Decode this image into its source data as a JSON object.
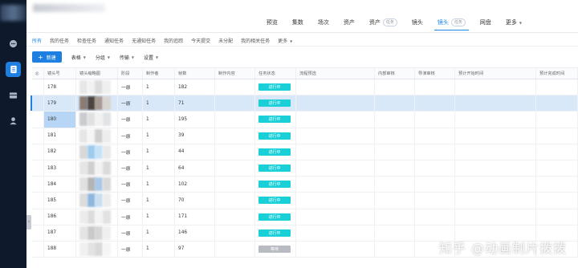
{
  "header": {
    "tabs": [
      {
        "label": "预览",
        "badge": null
      },
      {
        "label": "集数",
        "badge": null
      },
      {
        "label": "场次",
        "badge": null
      },
      {
        "label": "资产",
        "badge": null
      },
      {
        "label": "资产",
        "badge": "任务"
      },
      {
        "label": "镜头",
        "badge": null
      },
      {
        "label": "镜头",
        "badge": "任务",
        "active": true
      },
      {
        "label": "网盘",
        "badge": null
      },
      {
        "label": "更多",
        "badge": null
      }
    ]
  },
  "subtabs": [
    "所有",
    "我的任务",
    "检查任务",
    "通知任务",
    "无通知任务",
    "我的追踪",
    "今天提交",
    "未分配",
    "我的相关任务",
    "更多"
  ],
  "toolbar": {
    "new_label": "新建",
    "items": [
      "表格",
      "分组",
      "传输",
      "设置"
    ]
  },
  "table": {
    "columns": [
      "",
      "镜头号",
      "镜头缩略图",
      "阶段",
      "制作者",
      "帧数",
      "制作内容",
      "任务状态",
      "流程预选",
      "内部审核",
      "导演审核",
      "预计开始时间",
      "预计完成时间"
    ],
    "rows": [
      {
        "shot": "178",
        "stage": "一原",
        "maker": "1",
        "frames": "182",
        "status": "进行中",
        "status_color": "#1ad0d8"
      },
      {
        "shot": "179",
        "stage": "一原",
        "maker": "1",
        "frames": "71",
        "status": "进行中",
        "status_color": "#1ad0d8"
      },
      {
        "shot": "180",
        "stage": "一原",
        "maker": "1",
        "frames": "195",
        "status": "进行中",
        "status_color": "#1ad0d8"
      },
      {
        "shot": "181",
        "stage": "一原",
        "maker": "1",
        "frames": "39",
        "status": "进行中",
        "status_color": "#1ad0d8"
      },
      {
        "shot": "182",
        "stage": "一原",
        "maker": "1",
        "frames": "44",
        "status": "进行中",
        "status_color": "#1ad0d8"
      },
      {
        "shot": "183",
        "stage": "一原",
        "maker": "1",
        "frames": "64",
        "status": "进行中",
        "status_color": "#1ad0d8"
      },
      {
        "shot": "184",
        "stage": "一原",
        "maker": "1",
        "frames": "102",
        "status": "进行中",
        "status_color": "#1ad0d8"
      },
      {
        "shot": "185",
        "stage": "一原",
        "maker": "1",
        "frames": "70",
        "status": "进行中",
        "status_color": "#1ad0d8"
      },
      {
        "shot": "186",
        "stage": "一原",
        "maker": "1",
        "frames": "171",
        "status": "进行中",
        "status_color": "#1ad0d8"
      },
      {
        "shot": "187",
        "stage": "一原",
        "maker": "1",
        "frames": "146",
        "status": "进行中",
        "status_color": "#1ad0d8"
      },
      {
        "shot": "188",
        "stage": "一原",
        "maker": "1",
        "frames": "97",
        "status": "等待",
        "status_color": "#b8bcc2"
      }
    ]
  },
  "watermark": "知乎 @动画制片拨拨",
  "colors": {
    "accent": "#1f7fe0",
    "sidebar": "#0e1a2b",
    "hover_row": "#d8e8f9"
  },
  "sidebar_icons": [
    "chat-icon",
    "document-icon",
    "inbox-icon",
    "user-icon"
  ]
}
